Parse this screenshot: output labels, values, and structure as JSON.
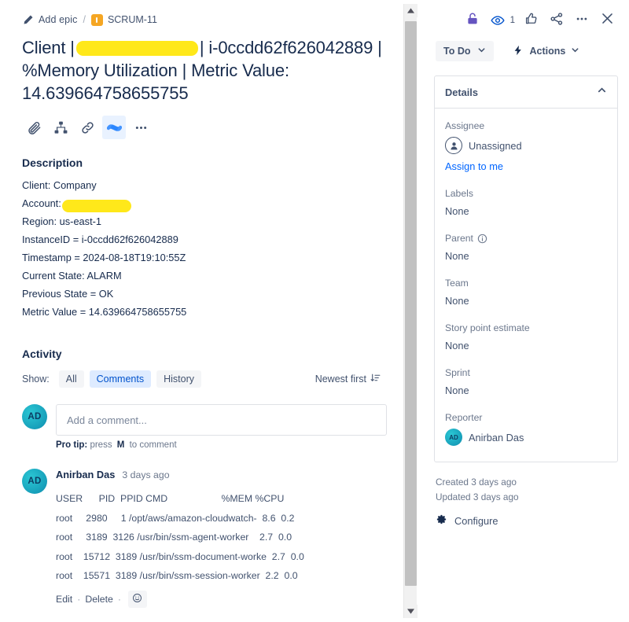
{
  "breadcrumb": {
    "add_epic": "Add epic",
    "separator": "/",
    "issue_key": "SCRUM-11"
  },
  "issue": {
    "title_part1": "Client |",
    "title_part2": "| i-0ccdd62f626042889 | %Memory Utilization | Metric Value: 14.639664758655755"
  },
  "toolbar": {
    "attach": "attach-icon",
    "child": "child-issue-icon",
    "link": "link-icon",
    "confluence": "confluence-icon",
    "more": "more-icon"
  },
  "description": {
    "heading": "Description",
    "line_client": "Client: Company",
    "line_account_label": "Account:",
    "lines": [
      "Region: us-east-1",
      "InstanceID = i-0ccdd62f626042889",
      "Timestamp = 2024-08-18T19:10:55Z",
      "Current State: ALARM",
      "Previous State = OK",
      "Metric Value = 14.639664758655755"
    ]
  },
  "activity": {
    "heading": "Activity",
    "show_label": "Show:",
    "filters": [
      {
        "label": "All",
        "active": false
      },
      {
        "label": "Comments",
        "active": true
      },
      {
        "label": "History",
        "active": false
      }
    ],
    "sort_label": "Newest first"
  },
  "composer": {
    "avatar_initials": "AD",
    "placeholder": "Add a comment...",
    "protip_prefix": "Pro tip:",
    "protip_press": "press",
    "protip_key": "M",
    "protip_suffix": "to comment"
  },
  "comment": {
    "avatar_initials": "AD",
    "author": "Anirban Das",
    "timestamp": "3 days ago",
    "process_table": {
      "header": "USER      PID  PPID CMD                    %MEM %CPU",
      "rows": [
        "root     2980     1 /opt/aws/amazon-cloudwatch-  8.6  0.2",
        "root     3189  3126 /usr/bin/ssm-agent-worker    2.7  0.0",
        "root    15712  3189 /usr/bin/ssm-document-worke  2.7  0.0",
        "root    15571  3189 /usr/bin/ssm-session-worker  2.2  0.0"
      ]
    },
    "edit_label": "Edit",
    "delete_label": "Delete",
    "separator": "·"
  },
  "right_panel": {
    "watch_count": "1",
    "status": "To Do",
    "actions_label": "Actions",
    "details": {
      "title": "Details",
      "fields": [
        {
          "label": "Assignee",
          "value": "Unassigned"
        },
        {
          "label": "Labels",
          "value": "None"
        },
        {
          "label": "Parent",
          "value": "None"
        },
        {
          "label": "Team",
          "value": "None"
        },
        {
          "label": "Story point estimate",
          "value": "None"
        },
        {
          "label": "Sprint",
          "value": "None"
        },
        {
          "label": "Reporter",
          "value": "Anirban Das"
        }
      ],
      "assign_to_me": "Assign to me",
      "reporter_initials": "AD"
    },
    "created": "Created 3 days ago",
    "updated": "Updated 3 days ago",
    "configure": "Configure"
  },
  "colors": {
    "redaction": "#ffe81a",
    "epic_icon": "#f5a623",
    "link_blue": "#0065ff",
    "chip_active_bg": "#deebff",
    "chip_active_text": "#0052cc",
    "avatar_teal": "#179fba",
    "lock_purple": "#6554c0"
  }
}
